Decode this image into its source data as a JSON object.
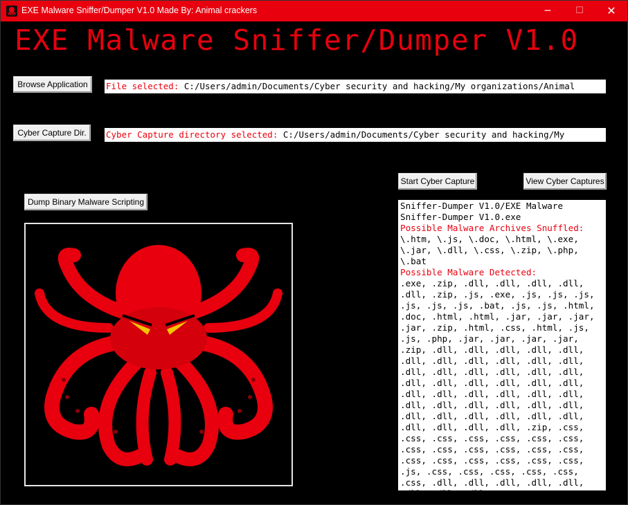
{
  "window": {
    "title": "EXE Malware Sniffer/Dumper V1.0 Made By: Animal crackers",
    "controls": {
      "minimize": "─",
      "maximize": "☐",
      "close": "✕"
    }
  },
  "banner": "EXE Malware Sniffer/Dumper V1.0",
  "browse": {
    "button_label": "Browse Application",
    "field_label": "File selected:",
    "field_value": "C:/Users/admin/Documents/Cyber security and hacking/My organizations/Animal"
  },
  "capture_dir": {
    "button_label": "Cyber Capture Dir.",
    "field_label": "Cyber Capture directory selected:",
    "field_value": "C:/Users/admin/Documents/Cyber security and hacking/My"
  },
  "actions": {
    "start_capture": "Start Cyber Capture",
    "view_captures": "View Cyber Captures",
    "dump_binary": "Dump Binary Malware Scripting"
  },
  "output": {
    "file_path": "Sniffer-Dumper V1.0/EXE Malware Sniffer-Dumper V1.0.exe",
    "archives_heading": "Possible Malware Archives Snuffled:",
    "archives_list": "\\.htm, \\.js, \\.doc, \\.html, \\.exe, \\.jar, \\.dll, \\.css, \\.zip, \\.php, \\.bat",
    "detected_heading": "Possible Malware Detected:",
    "detected_list": ".exe, .zip, .dll, .dll, .dll, .dll, .dll, .zip, .js, .exe, .js, .js, .js, .js, .js, .js, .bat, .js, .js, .html, .doc, .html, .html, .jar, .jar, .jar, .jar, .zip, .html, .css, .html, .js, .js, .php, .jar, .jar, .jar, .jar, .zip, .dll, .dll, .dll, .dll, .dll, .dll, .dll, .dll, .dll, .dll, .dll, .dll, .dll, .dll, .dll, .dll, .dll, .dll, .dll, .dll, .dll, .dll, .dll, .dll, .dll, .dll, .dll, .dll, .dll, .dll, .dll, .dll, .dll, .dll, .dll, .dll, .dll, .dll, .dll, .dll, .dll, .dll, .dll, .dll, .dll, .zip, .css, .css, .css, .css, .css, .css, .css, .css, .css, .css, .css, .css, .css, .css, .css, .css, .css, .css, .css, .js, .css, .css, .css, .css, .css, .css, .dll, .dll, .dll, .dll, .dll, .dll, .dll, .dll,"
  },
  "colors": {
    "accent": "#e8000e",
    "background": "#000000"
  }
}
